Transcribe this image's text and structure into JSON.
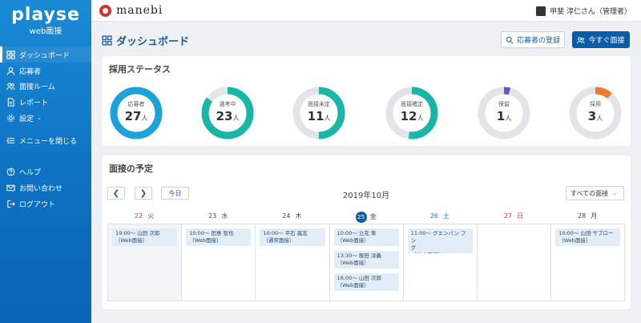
{
  "sidebar": {
    "brand": "playse",
    "sub": "web面接",
    "items": [
      {
        "label": "ダッシュボード",
        "icon": "dashboard-icon"
      },
      {
        "label": "応募者",
        "icon": "person-icon"
      },
      {
        "label": "面接ルーム",
        "icon": "people-icon"
      },
      {
        "label": "レポート",
        "icon": "document-icon"
      },
      {
        "label": "設定",
        "icon": "gear-icon"
      },
      {
        "label": "メニューを閉じる",
        "icon": "collapse-icon"
      },
      {
        "label": "ヘルプ",
        "icon": "help-icon"
      },
      {
        "label": "お問い合わせ",
        "icon": "mail-icon"
      },
      {
        "label": "ログアウト",
        "icon": "logout-icon"
      }
    ]
  },
  "topbar": {
    "logo_text": "manebi",
    "user_name": "甲斐 淳仁さん（管理者）"
  },
  "header": {
    "title": "ダッシュボード",
    "register_label": "応募者の登録",
    "interview_now_label": "今すぐ面接"
  },
  "status": {
    "title": "採用ステータス",
    "unit": "人",
    "items": [
      {
        "label": "応募者",
        "value": "27",
        "fraction": 1.0,
        "color": "#1aa3d9"
      },
      {
        "label": "選考中",
        "value": "23",
        "fraction": 0.85,
        "color": "#17b6a6"
      },
      {
        "label": "面接未定",
        "value": "11",
        "fraction": 0.5,
        "color": "#17b6a6"
      },
      {
        "label": "面接確定",
        "value": "12",
        "fraction": 0.52,
        "color": "#17b6a6"
      },
      {
        "label": "保留",
        "value": "1",
        "fraction": 0.04,
        "color": "#6b52d1"
      },
      {
        "label": "採用",
        "value": "3",
        "fraction": 0.11,
        "color": "#f47a2a"
      }
    ]
  },
  "schedule": {
    "title": "面接の予定",
    "today_label": "今日",
    "month_label": "2019年10月",
    "filter_label": "すべての面接",
    "days": [
      {
        "num": "22",
        "dow": "火",
        "color": "#d43b3b"
      },
      {
        "num": "23",
        "dow": "水",
        "color": "#444444"
      },
      {
        "num": "24",
        "dow": "木",
        "color": "#444444"
      },
      {
        "num": "25",
        "dow": "金",
        "color": "#444444"
      },
      {
        "num": "26",
        "dow": "土",
        "color": "#1d75c9"
      },
      {
        "num": "27",
        "dow": "日",
        "color": "#d43b3b"
      },
      {
        "num": "28",
        "dow": "月",
        "color": "#444444"
      }
    ],
    "events": [
      {
        "day": 0,
        "slot": 0,
        "line1": "19:00～ 山田 次郎",
        "line2": "（Web面接）"
      },
      {
        "day": 1,
        "slot": 0,
        "line1": "10:00～ 田島 智也",
        "line2": "（Web面接）"
      },
      {
        "day": 2,
        "slot": 0,
        "line1": "10:00～ 平石 嵐志",
        "line2": "（通常面接）"
      },
      {
        "day": 3,
        "slot": 0,
        "line1": "10:00～ 立花 隼",
        "line2": "（Web面接）"
      },
      {
        "day": 3,
        "slot": 1,
        "line1": "13:30～ 飯田 淳義",
        "line2": "（Web面接）"
      },
      {
        "day": 3,
        "slot": 2,
        "line1": "16:00～ 山田 次郎",
        "line2": "（Web面接）"
      },
      {
        "day": 4,
        "slot": 0,
        "line1": "11:00～ グエンバン フン",
        "line2": "グ",
        "line3": "（Web面接）"
      },
      {
        "day": 6,
        "slot": 0,
        "line1": "10:00～ 山田 サブロー",
        "line2": "（Web面接）"
      }
    ]
  }
}
